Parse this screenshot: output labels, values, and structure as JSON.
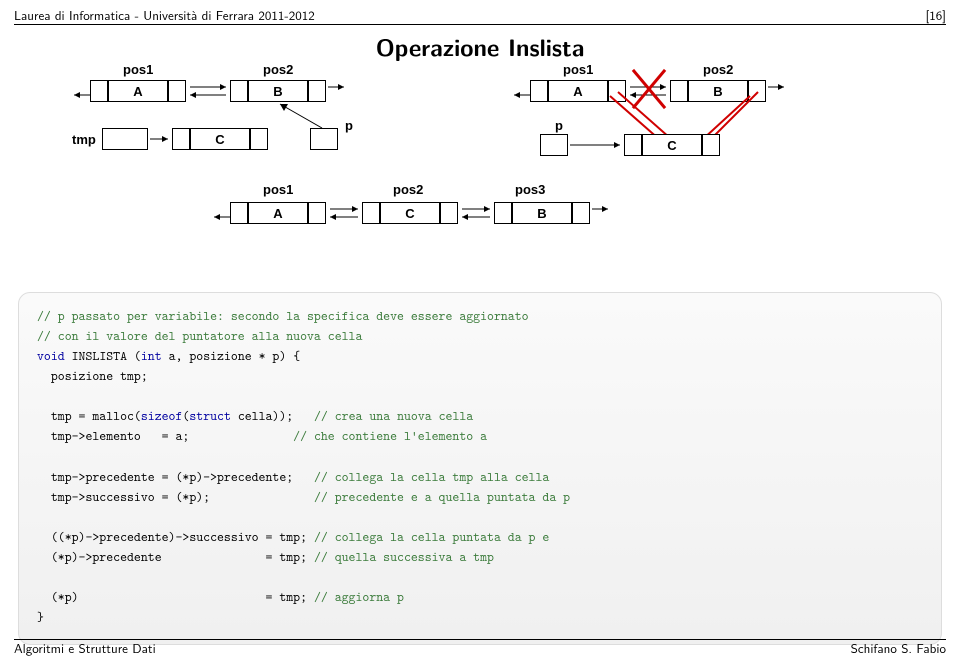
{
  "header": {
    "left": "Laurea di Informatica - Università di Ferrara 2011-2012",
    "right": "[16]"
  },
  "title": "Operazione Inslista",
  "diagram": {
    "top_left": {
      "pos1": "pos1",
      "pos2": "pos2",
      "A": "A",
      "B": "B"
    },
    "top_right": {
      "pos1": "pos1",
      "pos2": "pos2",
      "A": "A",
      "B": "B"
    },
    "mid_left": {
      "tmp": "tmp",
      "C": "C",
      "p": "p"
    },
    "mid_right": {
      "p": "p",
      "C": "C"
    },
    "bottom": {
      "pos1": "pos1",
      "pos2": "pos2",
      "pos3": "pos3",
      "A": "A",
      "C": "C",
      "B": "B"
    }
  },
  "code": {
    "l1": "// p passato per variabile: secondo la specifica deve essere aggiornato",
    "l2": "// con il valore del puntatore alla nuova cella",
    "l3a": "void",
    "l3b": " INSLISTA (",
    "l3c": "int",
    "l3d": " a, posizione * p) {",
    "l4": "  posizione tmp;",
    "l5a": "  tmp = malloc(",
    "l5b": "sizeof",
    "l5c": "(",
    "l5d": "struct",
    "l5e": " cella));   ",
    "l5f": "// crea una nuova cella",
    "l6a": "  tmp->elemento   = a;               ",
    "l6b": "// che contiene l'elemento a",
    "l7a": "  tmp->precedente = (*p)->precedente;   ",
    "l7b": "// collega la cella tmp alla cella",
    "l8a": "  tmp->successivo = (*p);               ",
    "l8b": "// precedente e a quella puntata da p",
    "l9a": "  ((*p)->precedente)->successivo = tmp; ",
    "l9b": "// collega la cella puntata da p e",
    "l10a": "  (*p)->precedente               = tmp; ",
    "l10b": "// quella successiva a tmp",
    "l11a": "  (*p)                           = tmp; ",
    "l11b": "// aggiorna p",
    "l12": "}"
  },
  "footer": {
    "left": "Algoritmi e Strutture Dati",
    "right": "Schifano S. Fabio"
  }
}
